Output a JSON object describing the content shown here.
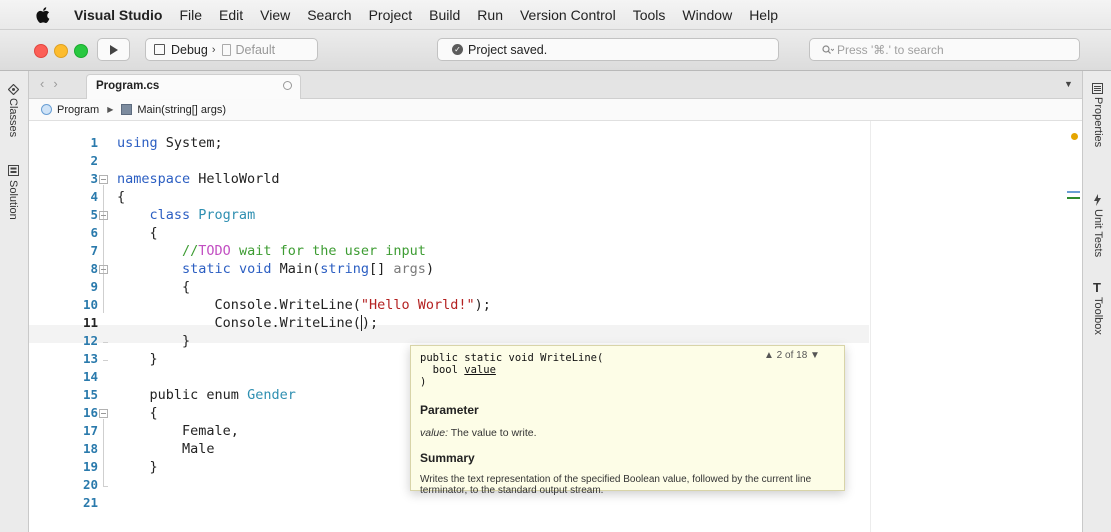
{
  "menubar": {
    "app": "Visual Studio",
    "items": [
      "File",
      "Edit",
      "View",
      "Search",
      "Project",
      "Build",
      "Run",
      "Version Control",
      "Tools",
      "Window",
      "Help"
    ]
  },
  "toolbar": {
    "config": "Debug",
    "target": "Default",
    "status": "Project saved.",
    "search_placeholder": "Press '⌘.' to search"
  },
  "left_pads": [
    "Classes",
    "Solution"
  ],
  "right_pads": [
    "Properties",
    "Unit Tests",
    "Toolbox"
  ],
  "tab": {
    "label": "Program.cs"
  },
  "breadcrumb": {
    "class": "Program",
    "method": "Main(string[] args)"
  },
  "editor": {
    "current_line": 11,
    "line_numbers": [
      "1",
      "2",
      "3",
      "4",
      "5",
      "6",
      "7",
      "8",
      "9",
      "10",
      "11",
      "12",
      "13",
      "14",
      "15",
      "16",
      "17",
      "18",
      "19",
      "20",
      "21"
    ],
    "code": {
      "l1_kw": "using",
      "l1_rest": " System;",
      "l3_kw": "namespace",
      "l3_rest": " HelloWorld",
      "l4": "{",
      "l5_kw": "class",
      "l5_type": "Program",
      "l6": "{",
      "l7_comment": "//",
      "l7_todo": "TODO",
      "l7_rest": " wait for the user input",
      "l8_kw1": "static",
      "l8_kw2": "void",
      "l8_name": "Main(",
      "l8_kw3": "string",
      "l8_rest": "[] ",
      "l8_param": "args",
      "l8_close": ")",
      "l9": "{",
      "l10_a": "Console.WriteLine(",
      "l10_str": "\"Hello World!\"",
      "l10_b": ");",
      "l11_a": "Console.WriteLine(",
      "l11_b": ");",
      "l12": "}",
      "l13": "}",
      "l15_a": "public enum ",
      "l15_type": "Gender",
      "l16": "{",
      "l17": "Female,",
      "l18": "Male",
      "l19": "}"
    }
  },
  "tooltip": {
    "sig_line1": "public static void WriteLine(",
    "sig_type": "bool",
    "sig_param": "value",
    "sig_close": ")",
    "counter": "▲ 2 of 18 ▼",
    "param_heading": "Parameter",
    "param_name": "value:",
    "param_desc": " The value to write.",
    "summary_heading": "Summary",
    "summary_text": "Writes the text representation of the specified Boolean value, followed by the current line terminator, to the standard output stream."
  }
}
